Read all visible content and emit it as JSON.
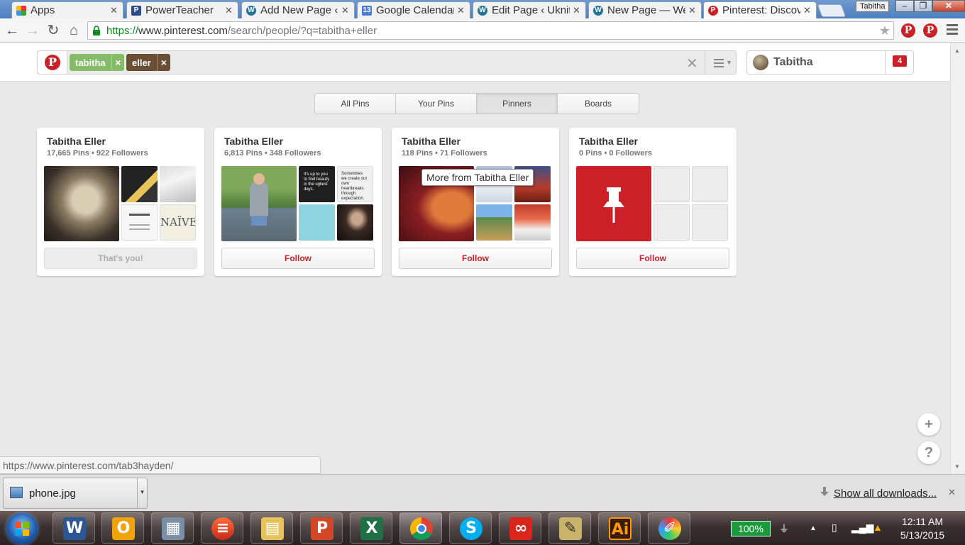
{
  "browser": {
    "tabs": [
      {
        "title": "Apps",
        "icon": "apps-grid-icon"
      },
      {
        "title": "PowerTeacher",
        "icon": "powerteacher-icon"
      },
      {
        "title": "Add New Page ‹",
        "icon": "wordpress-icon"
      },
      {
        "title": "Google Calendar",
        "icon": "google-calendar-icon"
      },
      {
        "title": "Edit Page ‹ Uknit",
        "icon": "wordpress-icon"
      },
      {
        "title": "New Page — We",
        "icon": "wordpress-icon"
      },
      {
        "title": "Pinterest: Discov",
        "icon": "pinterest-icon"
      }
    ],
    "profile_name": "Tabitha",
    "url_scheme": "https://",
    "url_host": "www.pinterest.com",
    "url_path": "/search/people/?q=tabitha+eller"
  },
  "search": {
    "tokens": [
      {
        "label": "tabitha",
        "color": "#86bb6a"
      },
      {
        "label": "eller",
        "color": "#6b4f35"
      }
    ],
    "token_remove": "×",
    "clear": "✕"
  },
  "user": {
    "name": "Tabitha",
    "notifications": "4"
  },
  "filters": {
    "items": [
      "All Pins",
      "Your Pins",
      "Pinners",
      "Boards"
    ],
    "selected": "Pinners"
  },
  "pinners": [
    {
      "name": "Tabitha Eller",
      "stats": "17,665 Pins • 922 Followers",
      "button": "That's you!"
    },
    {
      "name": "Tabitha Eller",
      "stats": "6,813 Pins • 348 Followers",
      "button": "Follow"
    },
    {
      "name": "Tabitha Eller",
      "stats": "118 Pins • 71 Followers",
      "button": "Follow"
    },
    {
      "name": "Tabitha Eller",
      "stats": "0 Pins • 0 Followers",
      "button": "Follow"
    }
  ],
  "thumb_text": {
    "naive": "NAÏVE",
    "quote1": "It's up to you to find beauty in the ugliest days.",
    "quote2": "Sometimes we create our own heartbreaks through expectation."
  },
  "tooltip": "More from Tabitha Eller",
  "status_url": "https://www.pinterest.com/tab3hayden/",
  "downloads": {
    "file": "phone.jpg",
    "show_all": "Show all downloads..."
  },
  "taskbar": {
    "apps": [
      "word-icon",
      "outlook-icon",
      "calculator-icon",
      "screen-app-icon",
      "file-explorer-icon",
      "powerpoint-icon",
      "excel-icon",
      "chrome-icon",
      "skype-icon",
      "creative-cloud-icon",
      "notes-icon",
      "illustrator-icon",
      "paint-icon"
    ],
    "battery": "100%",
    "time": "12:11 AM",
    "date": "5/13/2015"
  }
}
